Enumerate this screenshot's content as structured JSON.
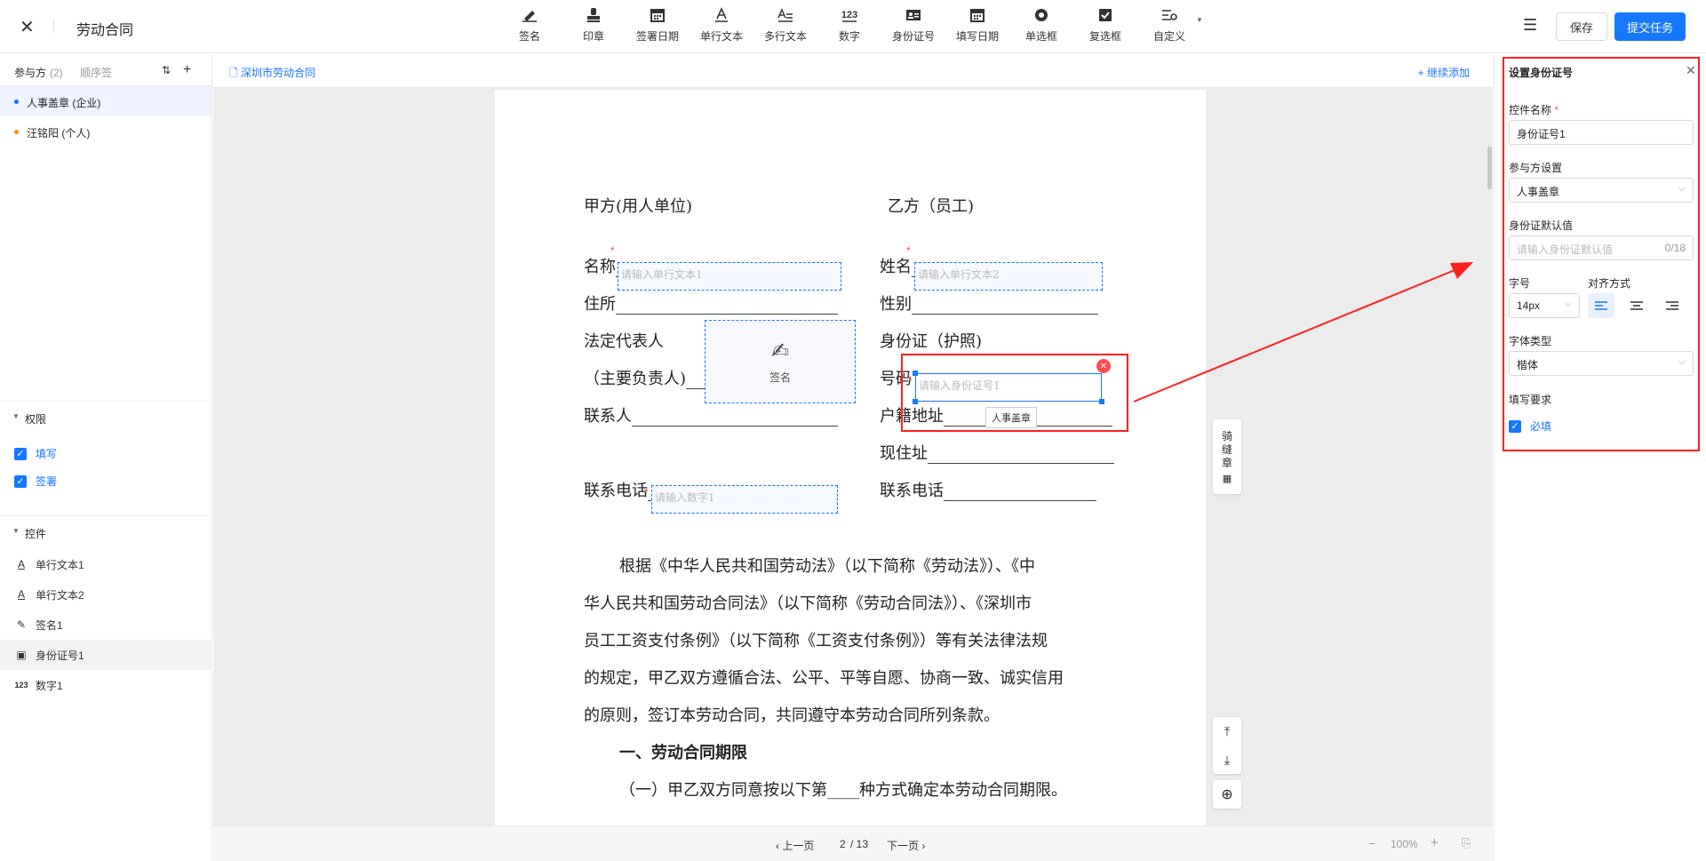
{
  "header": {
    "close_icon": "close-icon",
    "title": "劳动合同",
    "tools": [
      {
        "label": "签名",
        "icon": "signature-icon"
      },
      {
        "label": "印章",
        "icon": "stamp-icon"
      },
      {
        "label": "签署日期",
        "icon": "calendar-icon"
      },
      {
        "label": "单行文本",
        "icon": "text-line-icon"
      },
      {
        "label": "多行文本",
        "icon": "text-multiline-icon"
      },
      {
        "label": "数字",
        "icon": "number-icon",
        "glyph": "123"
      },
      {
        "label": "身份证号",
        "icon": "id-card-icon"
      },
      {
        "label": "填写日期",
        "icon": "calendar-icon"
      },
      {
        "label": "单选框",
        "icon": "radio-icon"
      },
      {
        "label": "复选框",
        "icon": "checkbox-icon"
      },
      {
        "label": "自定义",
        "icon": "custom-icon"
      }
    ],
    "menu_icon": "menu-icon",
    "save_label": "保存",
    "submit_label": "提交任务",
    "accent_color": "#1677ff"
  },
  "left_panel": {
    "tab_participants": "参与方",
    "participants_count": "(2)",
    "tab_order": "顺序签",
    "participants": [
      {
        "name": "人事盖章 (企业)",
        "color": "#1677ff",
        "selected": true
      },
      {
        "name": "汪铭阳 (个人)",
        "color": "#fa8c16",
        "selected": false
      }
    ],
    "permissions_title": "权限",
    "permissions": [
      {
        "label": "填写",
        "checked": true
      },
      {
        "label": "签署",
        "checked": true
      }
    ],
    "controls_title": "控件",
    "controls": [
      {
        "label": "单行文本1",
        "icon": "text-line-icon",
        "glyph": "A"
      },
      {
        "label": "单行文本2",
        "icon": "text-line-icon",
        "glyph": "A"
      },
      {
        "label": "签名1",
        "icon": "signature-icon",
        "glyph": "✎"
      },
      {
        "label": "身份证号1",
        "icon": "id-card-icon",
        "glyph": "▣",
        "selected": true
      },
      {
        "label": "数字1",
        "icon": "number-icon",
        "glyph": "123"
      }
    ]
  },
  "document": {
    "file_name": "深圳市劳动合同",
    "continue_add": "+ 继续添加",
    "party_a": "甲方(用人单位)",
    "party_b": "乙方（员工)",
    "a_name": "名称",
    "a_address": "住所",
    "a_rep": "法定代表人",
    "a_rep2": "（主要负责人)",
    "a_contact": "联系人",
    "a_phone": "联系电话",
    "b_name": "姓名",
    "b_gender": "性别",
    "b_id": "身份证（护照)",
    "b_id2": "号码",
    "b_hukou": "户籍地址",
    "b_addr": "现住址",
    "b_phone": "联系电话",
    "field_text1": "请输入单行文本1",
    "field_text2": "请输入单行文本2",
    "field_number1": "请输入数字1",
    "field_id1": "请输入身份证号1",
    "sign_label": "签名",
    "id_owner_tag": "人事盖章",
    "para1": "根据《中华人民共和国劳动法》（以下简称《劳动法》）、《中",
    "para2": "华人民共和国劳动合同法》（以下简称《劳动合同法》）、《深圳市",
    "para3": "员工工资支付条例》（以下简称《工资支付条例》）等有关法律法规",
    "para4": "的规定，甲乙双方遵循合法、公平、平等自愿、协商一致、诚实信用",
    "para5": "的原则，签订本劳动合同，共同遵守本劳动合同所列条款。",
    "section1": "一、劳动合同期限",
    "clause1": "（一）甲乙双方同意按以下第____种方式确定本劳动合同期限。",
    "seam_stamp": [
      "骑",
      "缝",
      "章"
    ]
  },
  "pagination": {
    "prev": "上一页",
    "current": "2",
    "total": "/ 13",
    "next": "下一页",
    "zoom_out": "−",
    "zoom": "100%",
    "zoom_in": "+"
  },
  "right_panel": {
    "title": "设置身份证号",
    "name_label": "控件名称",
    "name_value": "身份证号1",
    "party_label": "参与方设置",
    "party_value": "人事盖章",
    "default_label": "身份证默认值",
    "default_placeholder": "请输入身份证默认值",
    "default_count": "0/18",
    "size_label": "字号",
    "size_value": "14px",
    "align_label": "对齐方式",
    "align_selected": "left",
    "font_label": "字体类型",
    "font_value": "楷体",
    "require_label": "填写要求",
    "required_label": "必填",
    "required": true
  }
}
